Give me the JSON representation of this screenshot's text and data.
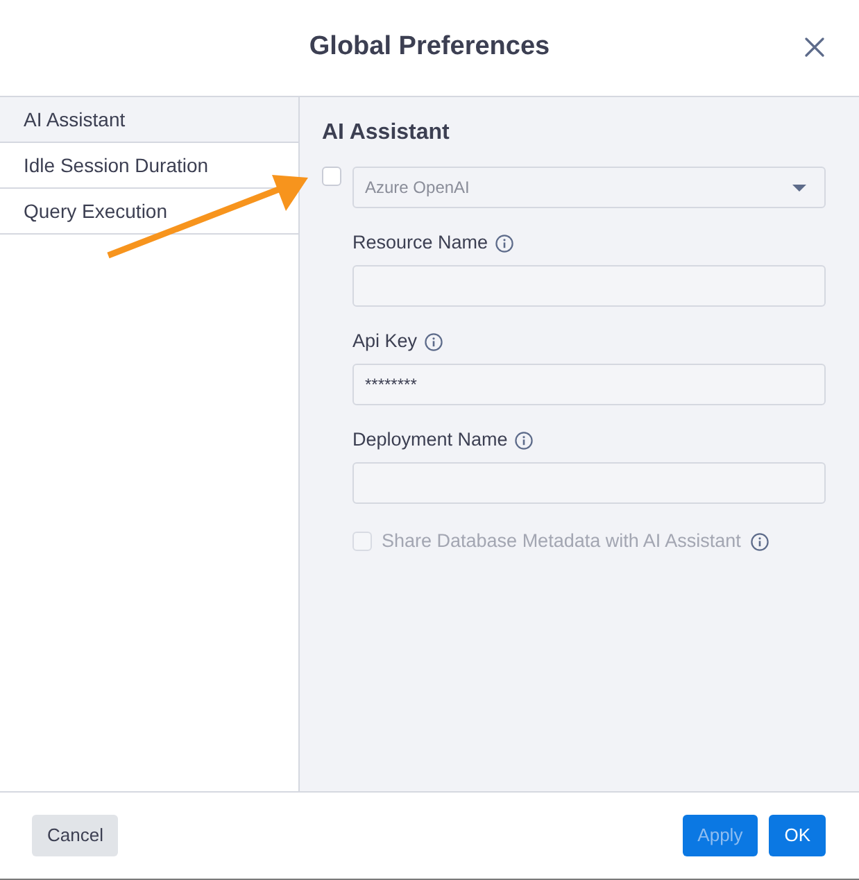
{
  "window": {
    "title": "Global Preferences"
  },
  "sidebar": {
    "items": [
      {
        "label": "AI Assistant",
        "selected": true
      },
      {
        "label": "Idle Session Duration",
        "selected": false
      },
      {
        "label": "Query Execution",
        "selected": false
      }
    ]
  },
  "panel": {
    "heading": "AI Assistant",
    "enable_checkbox": {
      "checked": false
    },
    "provider_select": {
      "value": "Azure OpenAI",
      "disabled": true
    },
    "fields": [
      {
        "label": "Resource Name"
      },
      {
        "label": "Api Key",
        "value": "********"
      },
      {
        "label": "Deployment Name"
      }
    ],
    "share_checkbox": {
      "label": "Share Database Metadata with AI Assistant",
      "checked": false,
      "disabled": true
    }
  },
  "footer": {
    "buttons": [
      {
        "label": "Cancel",
        "kind": "secondary",
        "disabled": false
      },
      {
        "label": "Apply",
        "kind": "primary",
        "disabled": true
      },
      {
        "label": "OK",
        "kind": "primary",
        "disabled": false
      }
    ]
  }
}
